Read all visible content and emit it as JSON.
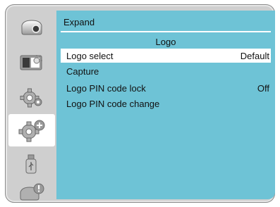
{
  "sidebar": {
    "tabs": [
      {
        "icon": "projector-icon",
        "active": false
      },
      {
        "icon": "image-adjust-icon",
        "active": false
      },
      {
        "icon": "settings-gear-icon",
        "active": false
      },
      {
        "icon": "expand-settings-icon",
        "active": true
      },
      {
        "icon": "usb-icon",
        "active": false
      },
      {
        "icon": "info-icon",
        "active": false
      }
    ]
  },
  "panel": {
    "title": "Expand",
    "section_title": "Logo",
    "rows": [
      {
        "label": "Logo select",
        "value": "Default",
        "selected": true
      },
      {
        "label": "Capture",
        "value": ""
      },
      {
        "label": "Logo PIN code lock",
        "value": "Off"
      },
      {
        "label": "Logo PIN code change",
        "value": ""
      }
    ]
  },
  "colors": {
    "panel_bg": "#6ec3d6",
    "frame_bg": "#cfcfcf",
    "selected_row": "#ffffff"
  }
}
